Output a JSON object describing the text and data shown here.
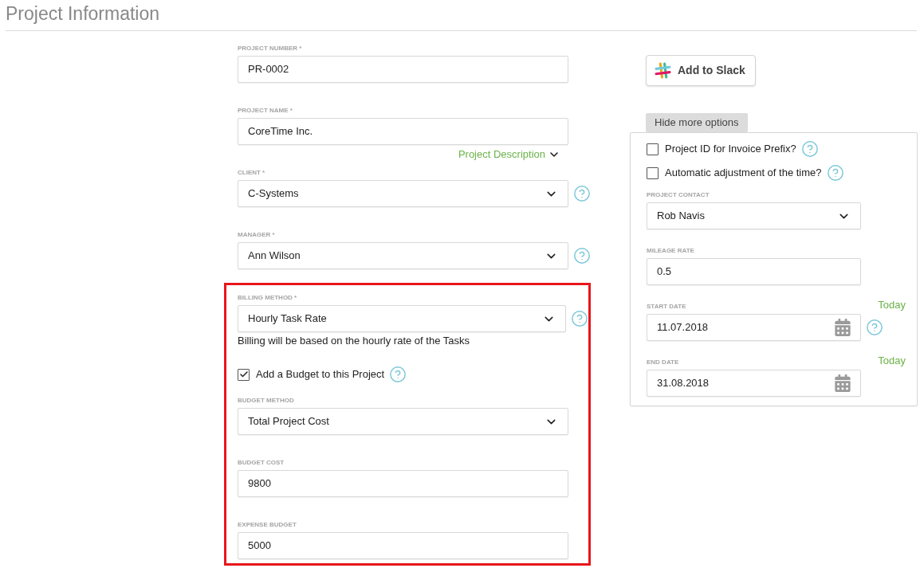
{
  "page_title": "Project Information",
  "main_fields": [
    {
      "kind": "text",
      "label": "PROJECT NUMBER *",
      "value": "PR-0002"
    },
    {
      "kind": "text",
      "label": "PROJECT NAME *",
      "value": "CoreTime Inc.",
      "link": "Project Description"
    },
    {
      "kind": "select",
      "label": "CLIENT *",
      "value": "C-Systems",
      "help": true
    },
    {
      "kind": "select",
      "label": "MANAGER *",
      "value": "Ann Wilson",
      "help": true
    }
  ],
  "billing": {
    "highlighted": true,
    "fields": [
      {
        "kind": "select",
        "label": "BILLING METHOD *",
        "value": "Hourly Task Rate",
        "help": true,
        "note": "Billing will be based on the hourly rate of the Tasks"
      },
      {
        "kind": "checkbox",
        "label": "Add a Budget to this Project",
        "checked": true,
        "help": true
      },
      {
        "kind": "select",
        "label": "BUDGET METHOD",
        "value": "Total Project Cost"
      },
      {
        "kind": "text",
        "label": "BUDGET COST",
        "value": "9800"
      },
      {
        "kind": "text",
        "label": "EXPENSE BUDGET",
        "value": "5000"
      }
    ]
  },
  "slack_button": {
    "label": "Add to Slack"
  },
  "options_toggle": {
    "label": "Hide more options"
  },
  "options": [
    {
      "kind": "checkbox",
      "label": "Project ID for Invoice Prefix?",
      "checked": false,
      "help": true
    },
    {
      "kind": "checkbox",
      "label": "Automatic adjustment of the time?",
      "checked": false,
      "help": true
    },
    {
      "kind": "select",
      "label": "PROJECT CONTACT",
      "value": "Rob Navis"
    },
    {
      "kind": "text",
      "label": "MILEAGE RATE",
      "value": "0.5"
    },
    {
      "kind": "date",
      "label": "START DATE",
      "value": "11.07.2018",
      "link": "Today",
      "help": true
    },
    {
      "kind": "date",
      "label": "END DATE",
      "value": "31.08.2018",
      "link": "Today"
    }
  ]
}
